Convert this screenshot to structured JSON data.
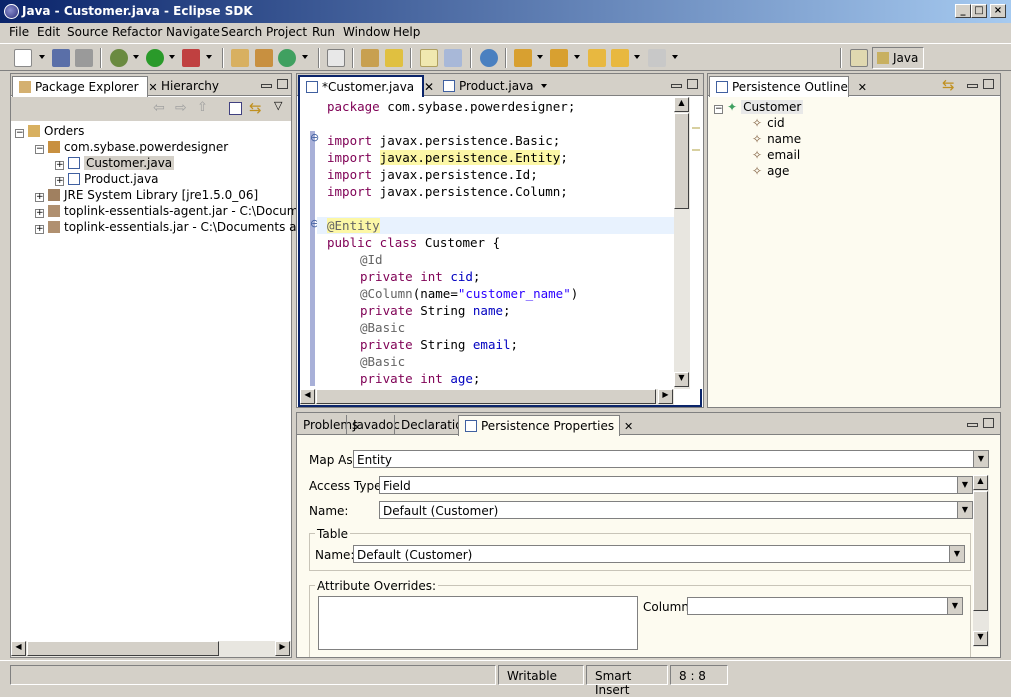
{
  "window": {
    "title": "Java - Customer.java - Eclipse SDK"
  },
  "menu": [
    "File",
    "Edit",
    "Source",
    "Refactor",
    "Navigate",
    "Search",
    "Project",
    "Run",
    "Window",
    "Help"
  ],
  "perspective": {
    "label": "Java"
  },
  "package_explorer": {
    "tabs": [
      "Package Explorer",
      "Hierarchy"
    ],
    "tree": [
      {
        "label": "Orders",
        "expander": "−"
      },
      {
        "label": "com.sybase.powerdesigner",
        "expander": "−"
      },
      {
        "label": "Customer.java",
        "expander": "+"
      },
      {
        "label": "Product.java",
        "expander": "+"
      },
      {
        "label": "JRE System Library [jre1.5.0_06]",
        "expander": "+"
      },
      {
        "label": "toplink-essentials-agent.jar - C:\\Documents an",
        "expander": "+"
      },
      {
        "label": "toplink-essentials.jar - C:\\Documents and Setti",
        "expander": "+"
      }
    ]
  },
  "editor": {
    "tabs": [
      "*Customer.java",
      "Product.java"
    ],
    "lines": {
      "l1": [
        "package",
        " com.sybase.powerdesigner;"
      ],
      "l3": [
        "import",
        " javax.persistence.Basic;"
      ],
      "l4": [
        "import",
        " ",
        "javax.persistence.Entity",
        ";"
      ],
      "l5": [
        "import",
        " javax.persistence.Id;"
      ],
      "l6": [
        "import",
        " javax.persistence.Column;"
      ],
      "l8": [
        "@Entity"
      ],
      "l9": [
        "public class",
        " Customer {"
      ],
      "l10": [
        "@Id"
      ],
      "l11": [
        "private int",
        " ",
        "cid",
        ";"
      ],
      "l12": [
        "@Column",
        "(name=",
        "\"customer_name\"",
        ")"
      ],
      "l13": [
        "private",
        " String ",
        "name",
        ";"
      ],
      "l14": [
        "@Basic"
      ],
      "l15": [
        "private",
        " String ",
        "email",
        ";"
      ],
      "l16": [
        "@Basic"
      ],
      "l17": [
        "private int",
        " ",
        "age",
        ";"
      ]
    }
  },
  "outline": {
    "tab": "Persistence Outline",
    "root": "Customer",
    "children": [
      "cid",
      "name",
      "email",
      "age"
    ]
  },
  "bottom": {
    "tabs": [
      "Problems",
      "Javadoc",
      "Declaration",
      "Persistence Properties"
    ],
    "map_as_label": "Map As:",
    "map_as_value": "Entity",
    "access_label": "Access Type:",
    "access_value": "Field",
    "name_label": "Name:",
    "name_value": "Default (Customer)",
    "table_group": "Table",
    "table_name_label": "Name:",
    "table_name_value": "Default (Customer)",
    "attr_group": "Attribute Overrides:",
    "column_label": "Column:",
    "column_value": ""
  },
  "status": {
    "writable": "Writable",
    "insert_mode": "Smart Insert",
    "position": "8 : 8"
  },
  "colors": {
    "keyword": "#7f0055",
    "annotation": "#646464",
    "string": "#2a00ff",
    "field": "#0000c0",
    "title_start": "#0a246a",
    "title_end": "#a6caf0"
  }
}
